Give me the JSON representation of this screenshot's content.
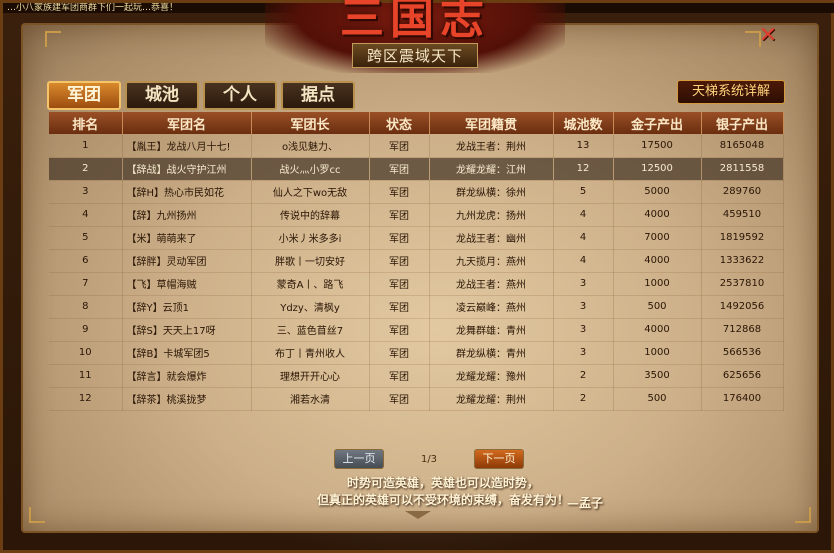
{
  "notice_text": "…小八家族建军团商群下们一起玩…恭喜！",
  "banner": {
    "title": "三国志",
    "subtitle": "跨区震域天下"
  },
  "tabs": [
    {
      "label": "军团",
      "active": true
    },
    {
      "label": "城池",
      "active": false
    },
    {
      "label": "个人",
      "active": false
    },
    {
      "label": "据点",
      "active": false
    }
  ],
  "ladder_button": "天梯系统详解",
  "close_glyph": "✕",
  "table": {
    "headers": [
      "排名",
      "军团名",
      "军团长",
      "状态",
      "军团籍贯",
      "城池数",
      "金子产出",
      "银子产出"
    ],
    "selected_row": 2,
    "rows": [
      {
        "rank": "1",
        "name": "【胤王】龙战八月十七!",
        "leader": "o浅见魅力、",
        "status": "军团",
        "origin": "龙战王者：荆州",
        "cities": "13",
        "gold": "17500",
        "silver": "8165048"
      },
      {
        "rank": "2",
        "name": "【辞战】战火守护江州",
        "leader": "战火灬小罗cc",
        "status": "军团",
        "origin": "龙耀龙耀：江州",
        "cities": "12",
        "gold": "12500",
        "silver": "2811558"
      },
      {
        "rank": "3",
        "name": "【辞H】热心市民如花",
        "leader": "仙人之下wo无敌",
        "status": "军团",
        "origin": "群龙纵横：徐州",
        "cities": "5",
        "gold": "5000",
        "silver": "289760"
      },
      {
        "rank": "4",
        "name": "【辞】九州扬州",
        "leader": "传说中的辞幕",
        "status": "军团",
        "origin": "九州龙虎：扬州",
        "cities": "4",
        "gold": "4000",
        "silver": "459510"
      },
      {
        "rank": "5",
        "name": "【米】萌萌来了",
        "leader": "小米丿米多多i",
        "status": "军团",
        "origin": "龙战王者：幽州",
        "cities": "4",
        "gold": "7000",
        "silver": "1819592"
      },
      {
        "rank": "6",
        "name": "【辞胖】灵动军团",
        "leader": "胖歌丨一切安好",
        "status": "军团",
        "origin": "九天揽月：燕州",
        "cities": "4",
        "gold": "4000",
        "silver": "1333622"
      },
      {
        "rank": "7",
        "name": "【飞】草帽海贼",
        "leader": "蒙奇A丨、路飞",
        "status": "军团",
        "origin": "龙战王者：燕州",
        "cities": "3",
        "gold": "1000",
        "silver": "2537810"
      },
      {
        "rank": "8",
        "name": "【辞Y】云顶1",
        "leader": "Ydzy、清枫y",
        "status": "军团",
        "origin": "凌云巅峰：燕州",
        "cities": "3",
        "gold": "500",
        "silver": "1492056"
      },
      {
        "rank": "9",
        "name": "【辞S】天天上17呀",
        "leader": "三、蓝色苜丝7",
        "status": "军团",
        "origin": "龙舞群雄：青州",
        "cities": "3",
        "gold": "4000",
        "silver": "712868"
      },
      {
        "rank": "10",
        "name": "【辞B】卡城军团5",
        "leader": "布丁丨青州收人",
        "status": "军团",
        "origin": "群龙纵横：青州",
        "cities": "3",
        "gold": "1000",
        "silver": "566536"
      },
      {
        "rank": "11",
        "name": "【辞言】就会爆炸",
        "leader": "理想开开心心",
        "status": "军团",
        "origin": "龙耀龙耀：豫州",
        "cities": "2",
        "gold": "3500",
        "silver": "625656"
      },
      {
        "rank": "12",
        "name": "【辞茶】桃溪拢梦",
        "leader": "湘若水清",
        "status": "军团",
        "origin": "龙耀龙耀：荆州",
        "cities": "2",
        "gold": "500",
        "silver": "176400"
      }
    ]
  },
  "pager": {
    "prev": "上一页",
    "info": "1/3",
    "next": "下一页"
  },
  "quote": {
    "line1": "时势可造英雄，英雄也可以造时势，",
    "line2": "但真正的英雄可以不受环境的束缚，奋发有为！",
    "author": "—孟子"
  }
}
